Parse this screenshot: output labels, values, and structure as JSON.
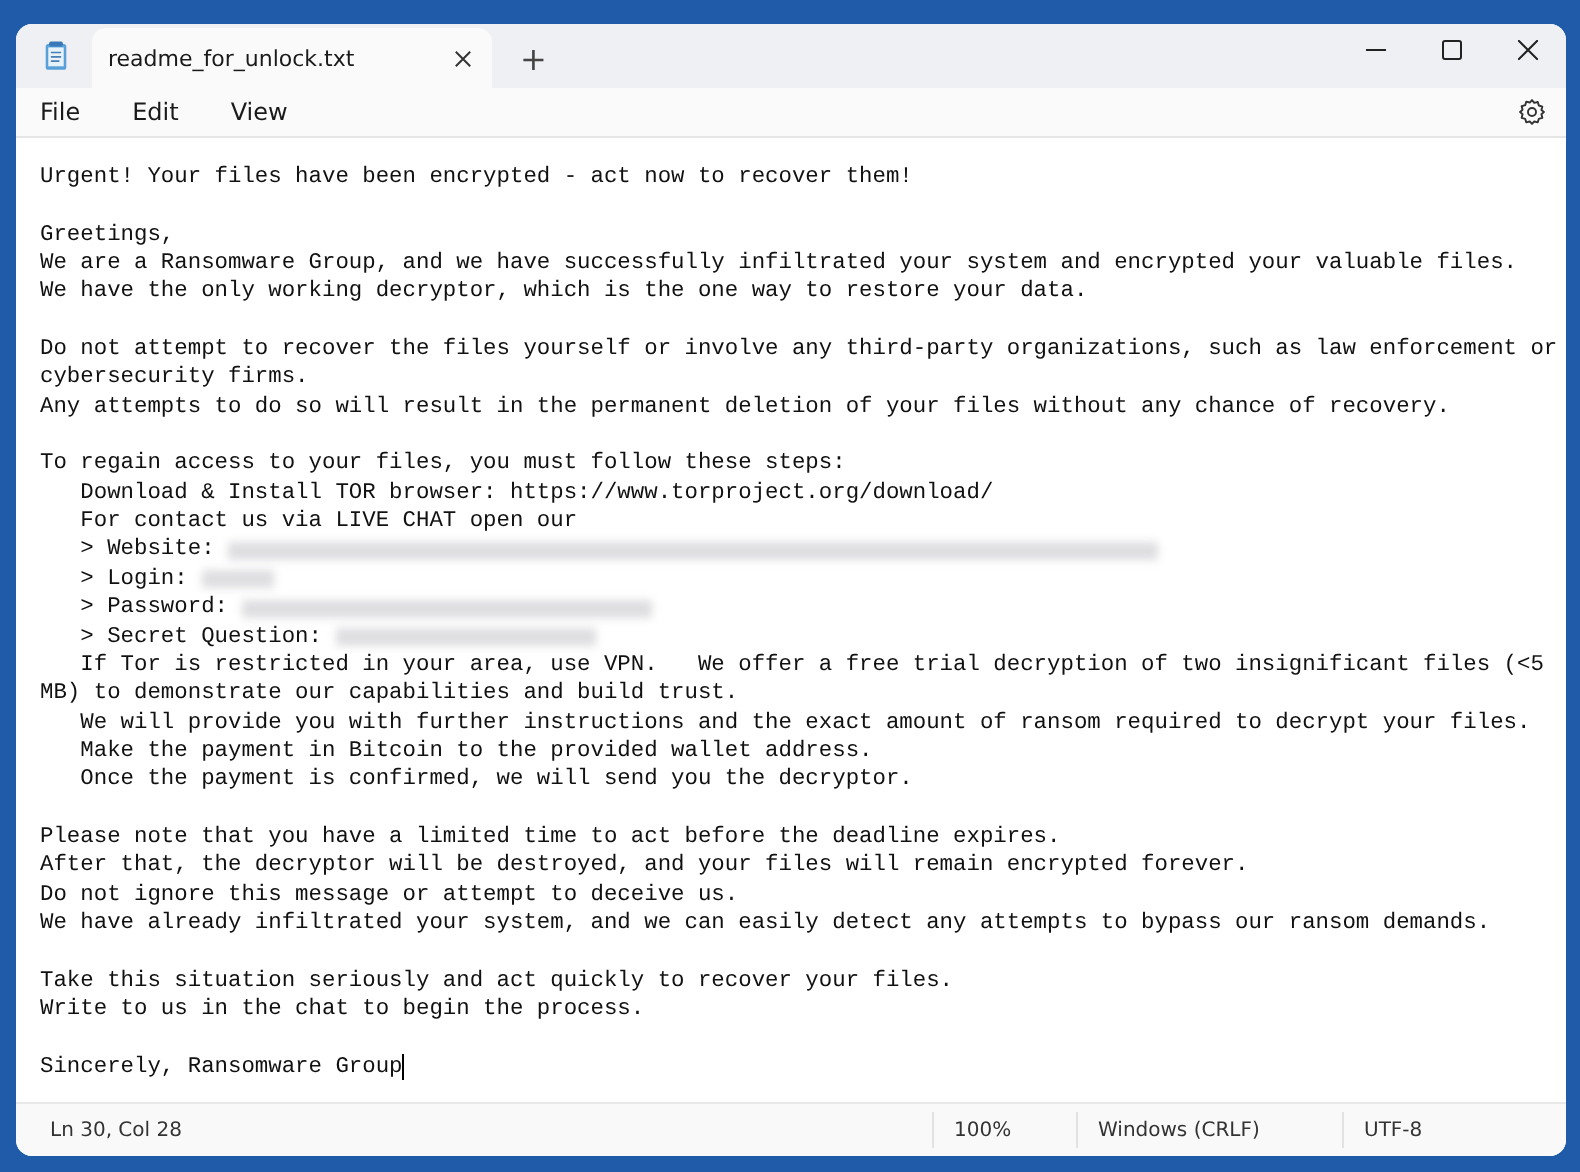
{
  "window": {
    "tab": {
      "title": "readme_for_unlock.txt",
      "selected": true
    },
    "new_tab": "+"
  },
  "menu": [
    {
      "label": "File"
    },
    {
      "label": "Edit"
    },
    {
      "label": "View"
    }
  ],
  "paragraphs": [
    {
      "lines": [
        {
          "text": "Urgent! Your files have been encrypted - act now to recover them!"
        }
      ]
    },
    {
      "lines": [
        {
          "text": "Greetings,"
        },
        {
          "text": "We are a Ransomware Group, and we have successfully infiltrated your system and encrypted your valuable files."
        },
        {
          "text": "We have the only working decryptor, which is the one way to restore your data."
        }
      ]
    },
    {
      "lines": [
        {
          "text": "Do not attempt to recover the files yourself or involve any third-party organizations, such as law enforcement or"
        },
        {
          "text": "cybersecurity firms."
        },
        {
          "text": "Any attempts to do so will result in the permanent deletion of your files without any chance of recovery."
        }
      ]
    },
    {
      "lines": [
        {
          "text": "To regain access to your files, you must follow these steps:"
        },
        {
          "text": "   Download & Install TOR browser: https://www.torproject.org/download/"
        },
        {
          "text": "   For contact us via LIVE CHAT open our"
        },
        {
          "text": "   > Website: ",
          "redacted": true
        },
        {
          "text": "   > Login: ",
          "redacted": true
        },
        {
          "text": "   > Password: ",
          "redacted": true
        },
        {
          "text": "   > Secret Question: ",
          "redacted": true
        },
        {
          "text": "   If Tor is restricted in your area, use VPN.   We offer a free trial decryption of two insignificant files (<5"
        },
        {
          "text": "MB) to demonstrate our capabilities and build trust."
        },
        {
          "text": "   We will provide you with further instructions and the exact amount of ransom required to decrypt your files."
        },
        {
          "text": "   Make the payment in Bitcoin to the provided wallet address."
        },
        {
          "text": "   Once the payment is confirmed, we will send you the decryptor."
        }
      ]
    },
    {
      "lines": [
        {
          "text": "Please note that you have a limited time to act before the deadline expires."
        },
        {
          "text": "After that, the decryptor will be destroyed, and your files will remain encrypted forever."
        },
        {
          "text": "Do not ignore this message or attempt to deceive us."
        },
        {
          "text": "We have already infiltrated your system, and we can easily detect any attempts to bypass our ransom demands."
        }
      ]
    },
    {
      "lines": [
        {
          "text": "Take this situation seriously and act quickly to recover your files."
        },
        {
          "text": "Write to us in the chat to begin the process."
        }
      ]
    },
    {
      "lines": [
        {
          "text": "Sincerely, Ransomware Group",
          "cursor": true
        }
      ]
    }
  ],
  "status_bar": {
    "position": "Ln 30, Col 28",
    "zoom": "100%",
    "line_endings": "Windows (CRLF)",
    "encoding": "UTF-8"
  }
}
